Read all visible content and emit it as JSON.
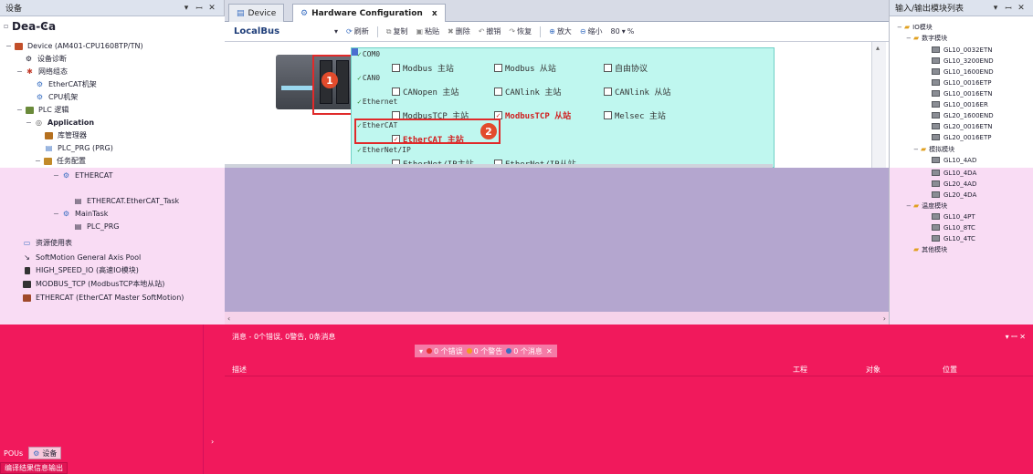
{
  "left_panel": {
    "title": "设备",
    "controls": {
      "pin": "▾",
      "dock": "ꟷ",
      "close": "✕"
    },
    "root_label": "Dea-Ͼa",
    "items": [
      {
        "label": "Device (AM401-CPU1608TP/TN)"
      },
      {
        "label": "设备诊断"
      },
      {
        "label": "网络组态"
      },
      {
        "label": "EtherCAT机架"
      },
      {
        "label": "CPU机架"
      },
      {
        "label": "PLC 逻辑"
      },
      {
        "label": "Application"
      },
      {
        "label": "库管理器"
      },
      {
        "label": "PLC_PRG (PRG)"
      },
      {
        "label": "任务配置"
      },
      {
        "label": "ETHERCAT"
      },
      {
        "label": "ETHERCAT.EtherCAT_Task"
      },
      {
        "label": "MainTask"
      },
      {
        "label": "PLC_PRG"
      },
      {
        "label": "资源使用表"
      },
      {
        "label": "SoftMotion General Axis Pool"
      },
      {
        "label": "HIGH_SPEED_IO (高速IO模块)"
      },
      {
        "label": "MODBUS_TCP (ModbusTCP本地从站)"
      },
      {
        "label": "ETHERCAT (EtherCAT Master SoftMotion)"
      }
    ],
    "bottom_tabs": [
      "POUs",
      "设备"
    ],
    "status_text": "编译结果信息输出"
  },
  "tabs": [
    {
      "label": "Device"
    },
    {
      "label": "Hardware Configuration",
      "close": "x"
    }
  ],
  "toolbar": {
    "bus_label": "LocalBus",
    "refresh": "刷新",
    "copy": "复制",
    "paste": "粘贴",
    "delete": "删除",
    "undo": "撤销",
    "redo": "恢复",
    "zoom_in": "放大",
    "zoom_out": "缩小",
    "zoom_value": "80",
    "zoom_unit": "%"
  },
  "config": {
    "groups": {
      "com0": "COM0",
      "can0": "CAN0",
      "ethernet": "Ethernet",
      "ethercat": "EtherCAT",
      "ethernetip": "EtherNet/IP"
    },
    "options": {
      "modbus_master": "Modbus 主站",
      "modbus_slave": "Modbus 从站",
      "free_protocol": "自由协议",
      "canopen_master": "CANopen 主站",
      "canlink_master": "CANlink 主站",
      "canlink_slave": "CANlink 从站",
      "modbustcp_master": "ModbusTCP 主站",
      "modbustcp_slave": "ModbusTCP 从站",
      "melsec_master": "Melsec 主站",
      "ethercat_master": "EtherCAT 主站",
      "ethernetip_master": "EtherNet/IP主站",
      "ethernetip_slave": "EtherNet/IP从站"
    },
    "markers": {
      "one": "1",
      "two": "2"
    }
  },
  "messages": {
    "header": "消息 - 0个错误, 0警告, 0条消息",
    "filter_errors": "0 个错误",
    "filter_warnings": "0 个警告",
    "filter_messages": "0 个消息",
    "clear": "✕",
    "col_description": "描述",
    "col_project": "工程",
    "col_object": "对象",
    "col_position": "位置",
    "controls": "▾ ꟷ ✕"
  },
  "right_panel": {
    "title": "输入/输出模块列表",
    "controls": {
      "pin": "▾",
      "dock": "ꟷ",
      "close": "✕"
    },
    "tree": [
      {
        "label": "IO模块",
        "kind": "folder"
      },
      {
        "label": "数字模块",
        "kind": "folder"
      },
      {
        "label": "GL10_0032ETN",
        "kind": "module"
      },
      {
        "label": "GL10_3200END",
        "kind": "module"
      },
      {
        "label": "GL10_1600END",
        "kind": "module"
      },
      {
        "label": "GL10_0016ETP",
        "kind": "module"
      },
      {
        "label": "GL10_0016ETN",
        "kind": "module"
      },
      {
        "label": "GL10_0016ER",
        "kind": "module"
      },
      {
        "label": "GL20_1600END",
        "kind": "module"
      },
      {
        "label": "GL20_0016ETN",
        "kind": "module"
      },
      {
        "label": "GL20_0016ETP",
        "kind": "module"
      },
      {
        "label": "模拟模块",
        "kind": "folder"
      },
      {
        "label": "GL10_4AD",
        "kind": "module"
      },
      {
        "label": "GL10_4DA",
        "kind": "module"
      },
      {
        "label": "GL20_4AD",
        "kind": "module"
      },
      {
        "label": "GL20_4DA",
        "kind": "module"
      },
      {
        "label": "温度模块",
        "kind": "folder"
      },
      {
        "label": "GL10_4PT",
        "kind": "module"
      },
      {
        "label": "GL10_8TC",
        "kind": "module"
      },
      {
        "label": "GL10_4TC",
        "kind": "module"
      },
      {
        "label": "其他模块",
        "kind": "folder"
      }
    ]
  },
  "colors": {
    "accent": "#1d3c78",
    "highlight_red": "#e02a2a",
    "pink_overlay": "#f1195c",
    "config_bg": "#bff7ef"
  }
}
